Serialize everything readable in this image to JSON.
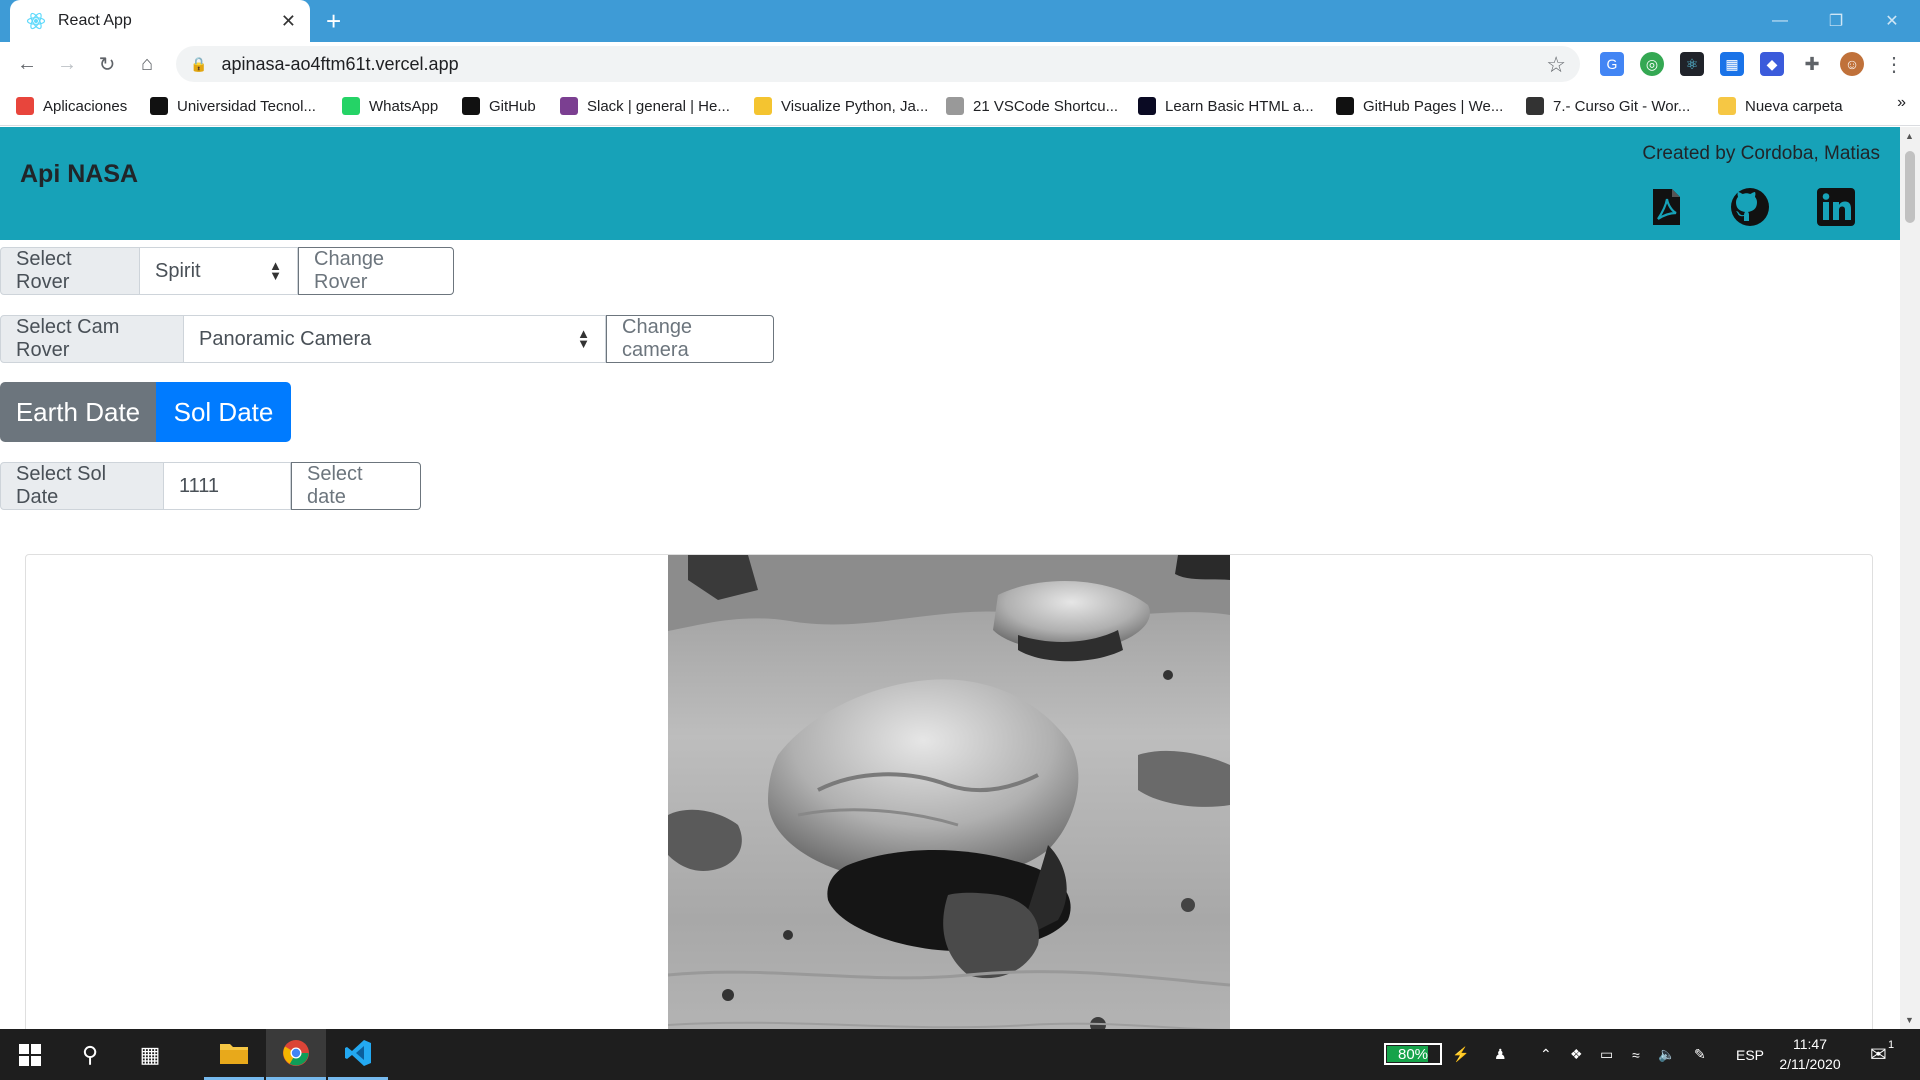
{
  "browser": {
    "tab_title": "React App",
    "tab_close": "✕",
    "new_tab": "+",
    "url": "apinasa-ao4ftm61t.vercel.app",
    "bookmarks": [
      {
        "label": "Aplicaciones",
        "icon": "apps-grid-icon",
        "color": "#e8453c"
      },
      {
        "label": "Universidad Tecnol...",
        "icon": "utn-icon",
        "color": "#111111"
      },
      {
        "label": "WhatsApp",
        "icon": "whatsapp-icon",
        "color": "#25d366"
      },
      {
        "label": "GitHub",
        "icon": "github-icon",
        "color": "#111111"
      },
      {
        "label": "Slack | general | He...",
        "icon": "slack-icon",
        "color": "#7b3f91"
      },
      {
        "label": "Visualize Python, Ja...",
        "icon": "python-icon",
        "color": "#f4c430"
      },
      {
        "label": "21 VSCode Shortcu...",
        "icon": "dash-icon",
        "color": "#999999"
      },
      {
        "label": "Learn Basic HTML a...",
        "icon": "freecodecamp-icon",
        "color": "#0a0a23"
      },
      {
        "label": "GitHub Pages | We...",
        "icon": "github-icon",
        "color": "#111111"
      },
      {
        "label": "7.- Curso Git - Wor...",
        "icon": "doc-icon",
        "color": "#333333"
      },
      {
        "label": "Nueva carpeta",
        "icon": "folder-icon",
        "color": "#f6c744"
      }
    ],
    "bookmarks_more": "»"
  },
  "app": {
    "brand": "Api NASA",
    "credits": "Created by Cordoba, Matias",
    "rover": {
      "label": "Select Rover",
      "value": "Spirit",
      "button": "Change Rover"
    },
    "camera": {
      "label": "Select Cam Rover",
      "value": "Panoramic Camera",
      "button": "Change camera"
    },
    "date_toggle": {
      "earth": "Earth Date",
      "sol": "Sol Date"
    },
    "sol": {
      "label": "Select Sol Date",
      "value": "1111",
      "button": "Select date"
    },
    "colors": {
      "header": "#17a2b8",
      "primary": "#007bff",
      "secondary": "#6c757d"
    }
  },
  "taskbar": {
    "battery": "80%",
    "battery_level": 0.8,
    "language": "ESP",
    "time": "11:47",
    "date": "2/11/2020",
    "notifications": "1"
  }
}
